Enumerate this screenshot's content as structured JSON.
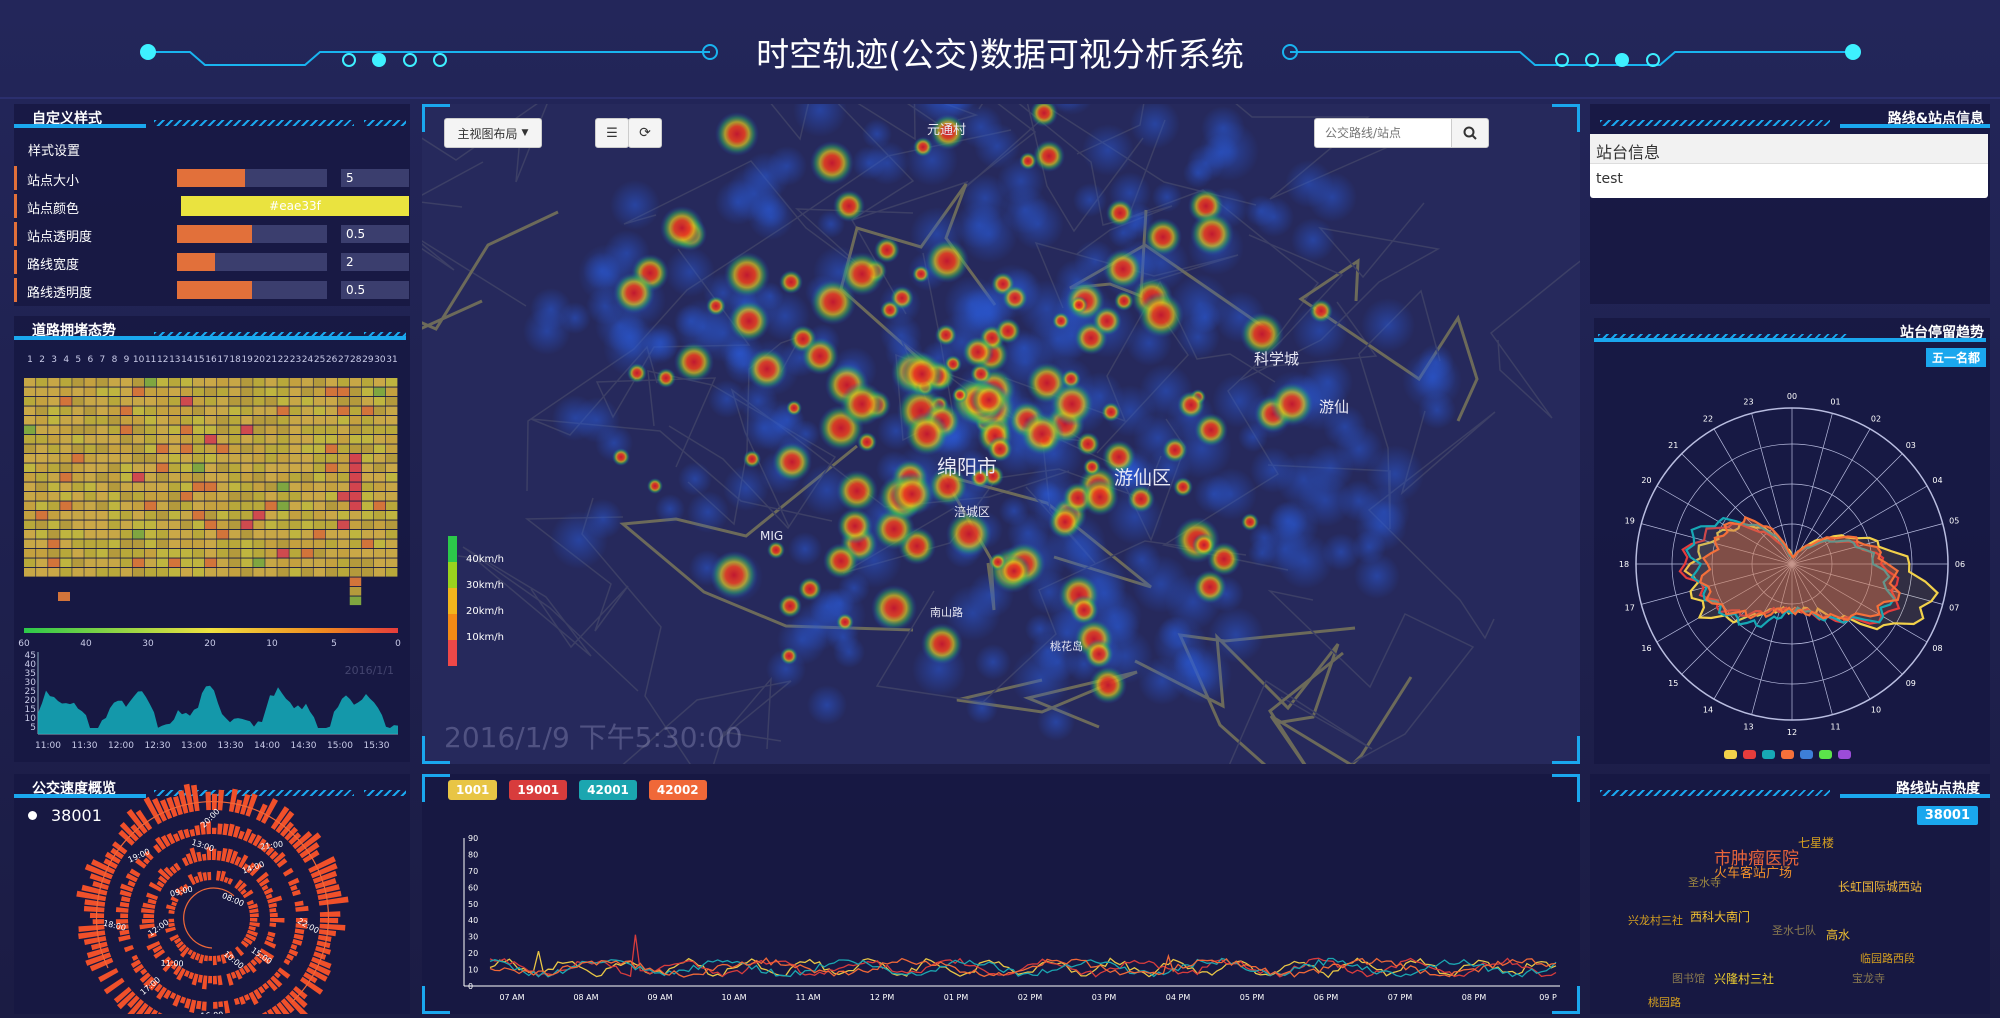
{
  "header": {
    "title": "时空轨迹(公交)数据可视分析系统"
  },
  "style_panel": {
    "title": "自定义样式",
    "section": "样式设置",
    "rows": [
      {
        "label": "站点大小",
        "value": "5",
        "fill": 0.45
      },
      {
        "label": "站点颜色",
        "value": "#eae33f"
      },
      {
        "label": "站点透明度",
        "value": "0.5",
        "fill": 0.5
      },
      {
        "label": "路线宽度",
        "value": "2",
        "fill": 0.25
      },
      {
        "label": "路线透明度",
        "value": "0.5",
        "fill": 0.5
      }
    ]
  },
  "congestion": {
    "title": "道路拥堵态势",
    "days": [
      "1",
      "2",
      "3",
      "4",
      "5",
      "6",
      "7",
      "8",
      "9",
      "10",
      "11",
      "12",
      "13",
      "14",
      "15",
      "16",
      "17",
      "18",
      "19",
      "20",
      "21",
      "22",
      "23",
      "24",
      "25",
      "26",
      "27",
      "28",
      "29",
      "30",
      "31"
    ],
    "scale_labels": [
      "60",
      "40",
      "30",
      "20",
      "10",
      "5",
      "0"
    ],
    "watermark": "2016/1/1",
    "yticks": [
      "45",
      "40",
      "35",
      "30",
      "25",
      "20",
      "15",
      "10",
      "5"
    ],
    "xticks": [
      "11:00",
      "11:30",
      "12:00",
      "12:30",
      "13:00",
      "13:30",
      "14:00",
      "14:30",
      "15:00",
      "15:30"
    ]
  },
  "speed_overview": {
    "title": "公交速度概览",
    "legend": "38001",
    "ring_labels": [
      "20:00",
      "21:00",
      "22:00",
      "19:00",
      "18:00",
      "17:00",
      "16:00",
      "15:00",
      "14:00",
      "13:00",
      "12:00",
      "11:00",
      "10:00",
      "09:00",
      "08:00"
    ]
  },
  "map": {
    "layout_button": "主视图布局",
    "search_placeholder": "公交路线/站点",
    "timestamp": "2016/1/9 下午5:30:00",
    "legend": [
      "40km/h",
      "30km/h",
      "20km/h",
      "10km/h"
    ],
    "legend_colors": [
      "#2cc84a",
      "#9ad21d",
      "#f2b51c",
      "#f38a15",
      "#ef4848"
    ],
    "places": [
      "元通村",
      "绵阳市",
      "游仙区",
      "科学城",
      "游仙",
      "涪城区",
      "MIG",
      "桃花岛",
      "南山路"
    ]
  },
  "route_info": {
    "title": "路线&站点信息",
    "card_title": "站台信息",
    "card_body": "test"
  },
  "dwell": {
    "title": "站台停留趋势",
    "badge": "五一名都",
    "hours": [
      "00",
      "01",
      "02",
      "03",
      "04",
      "05",
      "06",
      "07",
      "08",
      "09",
      "10",
      "11",
      "12",
      "13",
      "14",
      "15",
      "16",
      "17",
      "18",
      "19",
      "20",
      "21",
      "22",
      "23"
    ],
    "legend_colors": [
      "#f2d14a",
      "#e63c3c",
      "#17a8b5",
      "#f5703a",
      "#3d7fd8",
      "#5be34a",
      "#9b4cd8"
    ]
  },
  "line_chart": {
    "series": [
      {
        "name": "1001",
        "color": "#e8c545"
      },
      {
        "name": "19001",
        "color": "#d83c3c"
      },
      {
        "name": "42001",
        "color": "#1ba6b0"
      },
      {
        "name": "42002",
        "color": "#f06838"
      }
    ],
    "yticks": [
      "90",
      "80",
      "70",
      "60",
      "50",
      "40",
      "30",
      "20",
      "10",
      "0"
    ],
    "xticks": [
      "07 AM",
      "08 AM",
      "09 AM",
      "10 AM",
      "11 AM",
      "12 PM",
      "01 PM",
      "02 PM",
      "03 PM",
      "04 PM",
      "05 PM",
      "06 PM",
      "07 PM",
      "08 PM",
      "09 P"
    ]
  },
  "heat": {
    "title": "路线站点热度",
    "badge": "38001",
    "words": [
      {
        "t": "市肿瘤医院",
        "c": "#e8643a",
        "s": 17
      },
      {
        "t": "七星楼",
        "c": "#d6a020",
        "s": 12
      },
      {
        "t": "火车客站广场",
        "c": "#f0902a",
        "s": 13
      },
      {
        "t": "圣水寺",
        "c": "#a08a40",
        "s": 11
      },
      {
        "t": "长虹国际城西站",
        "c": "#f0b83a",
        "s": 12
      },
      {
        "t": "兴龙村三社",
        "c": "#d6a020",
        "s": 11
      },
      {
        "t": "西科大南门",
        "c": "#f0c030",
        "s": 12
      },
      {
        "t": "圣水七队",
        "c": "#8a7a50",
        "s": 11
      },
      {
        "t": "高水",
        "c": "#f0c030",
        "s": 12
      },
      {
        "t": "临园路西段",
        "c": "#d6a020",
        "s": 11
      },
      {
        "t": "图书馆",
        "c": "#8a7a50",
        "s": 11
      },
      {
        "t": "兴隆村三社",
        "c": "#f0d030",
        "s": 12
      },
      {
        "t": "宝龙寺",
        "c": "#8a7a50",
        "s": 11
      },
      {
        "t": "桃园路",
        "c": "#d6a020",
        "s": 11
      }
    ]
  }
}
